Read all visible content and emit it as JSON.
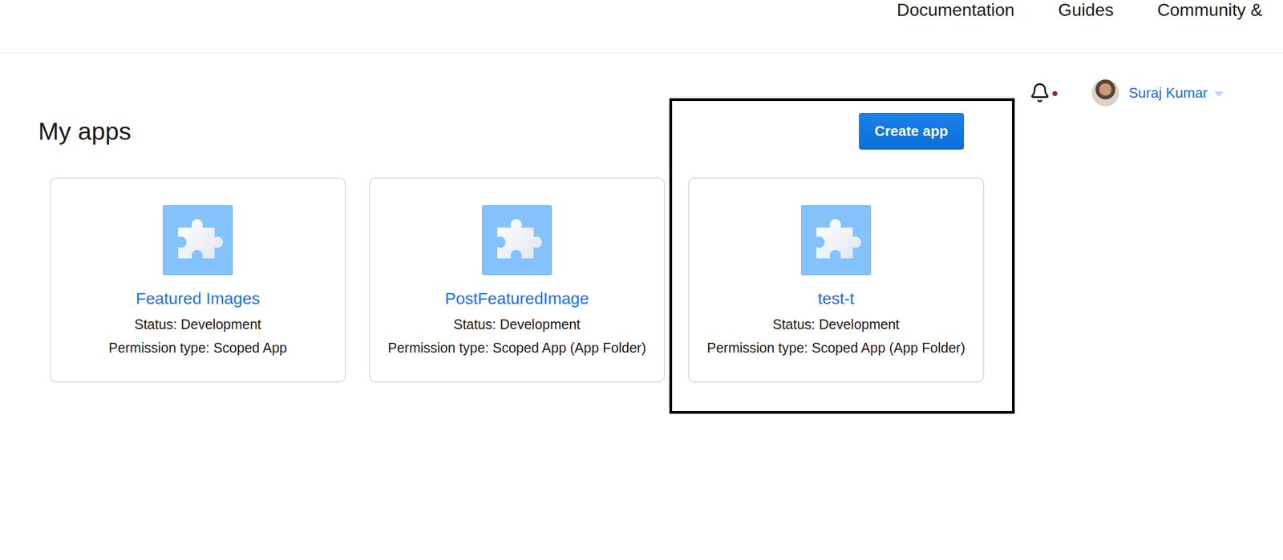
{
  "nav": {
    "links": [
      "Documentation",
      "Guides",
      "Community &"
    ]
  },
  "user": {
    "name": "Suraj Kumar",
    "notifications_unread": true
  },
  "page": {
    "title": "My apps"
  },
  "create_button": {
    "label": "Create app"
  },
  "highlight": {
    "visible": true
  },
  "apps": [
    {
      "name": "Featured Images",
      "status": "Status: Development",
      "permission": "Permission type: Scoped App"
    },
    {
      "name": "PostFeaturedImage",
      "status": "Status: Development",
      "permission": "Permission type: Scoped App (App Folder)"
    },
    {
      "name": "test-t",
      "status": "Status: Development",
      "permission": "Permission type: Scoped App (App Folder)"
    }
  ]
}
